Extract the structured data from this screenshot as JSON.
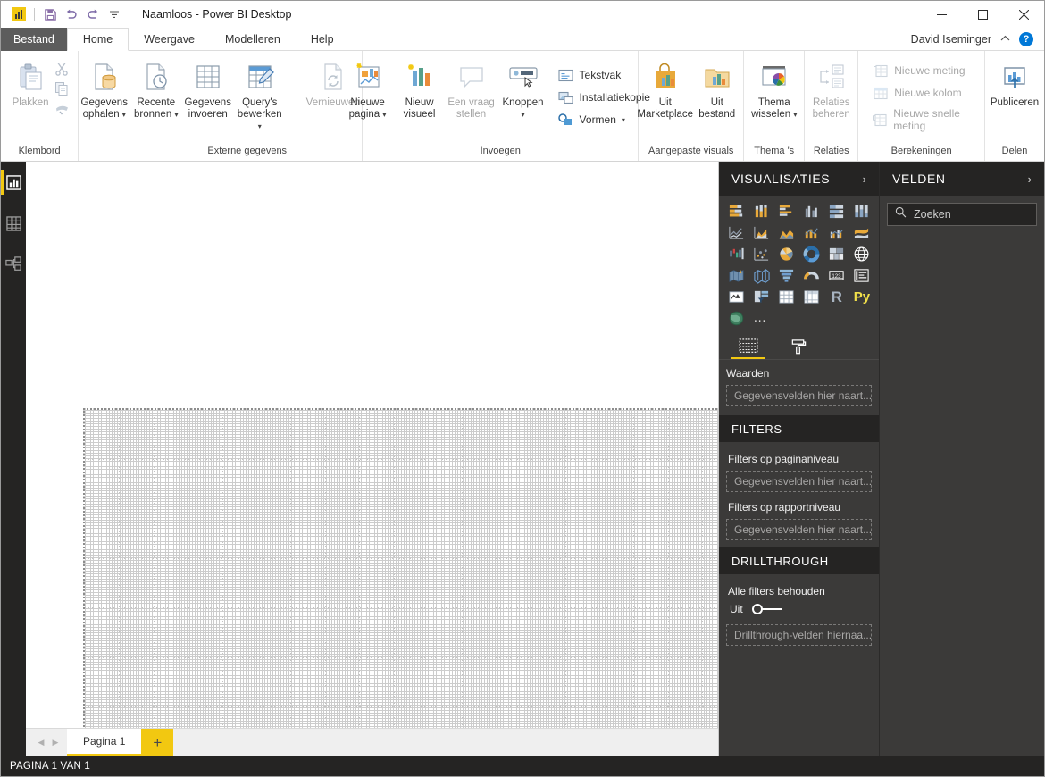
{
  "window": {
    "title": "Naamloos - Power BI Desktop",
    "minimize": "—",
    "maximize": "☐",
    "close": "✕",
    "quick_access": [
      "pbi-logo-icon",
      "save-icon",
      "undo-icon",
      "redo-icon",
      "customize-qat-icon"
    ]
  },
  "tabs": [
    {
      "label": "Bestand",
      "name": "tab-bestand"
    },
    {
      "label": "Home",
      "name": "tab-home"
    },
    {
      "label": "Weergave",
      "name": "tab-weergave"
    },
    {
      "label": "Modelleren",
      "name": "tab-modelleren"
    },
    {
      "label": "Help",
      "name": "tab-help"
    }
  ],
  "account": {
    "user_name": "David Iseminger",
    "collapse_ribbon": "⌃",
    "help": "?"
  },
  "ribbon": {
    "groups": [
      {
        "label": "Klembord",
        "buttons": [
          {
            "label": "Plakken",
            "icon": "paste-icon",
            "disabled": true
          },
          {
            "label": "Knippen",
            "icon": "cut-icon",
            "disabled": true
          },
          {
            "label": "Kopiëren",
            "icon": "copy-icon",
            "disabled": true
          },
          {
            "label": "Opmaak kopiëren/plakken",
            "icon": "format-painter-icon",
            "disabled": true
          }
        ]
      },
      {
        "label": "Externe gegevens",
        "buttons": [
          {
            "label": "Gegevens ophalen",
            "icon": "get-data-icon",
            "caret": true
          },
          {
            "label": "Recente bronnen",
            "icon": "recent-sources-icon",
            "caret": true
          },
          {
            "label": "Gegevens invoeren",
            "icon": "enter-data-icon",
            "caret": false
          },
          {
            "label": "Query's bewerken",
            "icon": "edit-queries-icon",
            "caret": true
          },
          {
            "label": "Vernieuwen",
            "icon": "refresh-icon",
            "caret": false,
            "disabled": true
          }
        ]
      },
      {
        "label": "Invoegen",
        "buttons": [
          {
            "label": "Nieuwe pagina",
            "icon": "new-page-icon",
            "caret": true
          },
          {
            "label": "Nieuw visueel",
            "icon": "new-visual-icon",
            "caret": false
          },
          {
            "label": "Een vraag stellen",
            "icon": "ask-question-icon",
            "caret": false,
            "disabled": true
          },
          {
            "label": "Knoppen",
            "icon": "buttons-icon",
            "caret": true
          }
        ],
        "small_buttons": [
          {
            "label": "Tekstvak",
            "icon": "text-box-icon"
          },
          {
            "label": "Installatiekopie",
            "icon": "image-icon"
          },
          {
            "label": "Vormen",
            "icon": "shapes-icon",
            "caret": true
          }
        ]
      },
      {
        "label": "Aangepaste visuals",
        "buttons": [
          {
            "label": "Uit Marketplace",
            "icon": "marketplace-icon"
          },
          {
            "label": "Uit bestand",
            "icon": "from-file-icon"
          }
        ]
      },
      {
        "label": "Thema 's",
        "buttons": [
          {
            "label": "Thema wisselen",
            "icon": "switch-theme-icon",
            "caret": true
          }
        ]
      },
      {
        "label": "Relaties",
        "buttons": [
          {
            "label": "Relaties beheren",
            "icon": "manage-relationships-icon",
            "disabled": true
          }
        ]
      },
      {
        "label": "Berekeningen",
        "small_buttons": [
          {
            "label": "Nieuwe meting",
            "icon": "new-measure-icon",
            "disabled": true
          },
          {
            "label": "Nieuwe kolom",
            "icon": "new-column-icon",
            "disabled": true
          },
          {
            "label": "Nieuwe snelle meting",
            "icon": "new-quick-measure-icon",
            "disabled": true
          }
        ]
      },
      {
        "label": "Delen",
        "buttons": [
          {
            "label": "Publiceren",
            "icon": "publish-icon"
          }
        ]
      }
    ]
  },
  "rail": [
    {
      "name": "view-report",
      "icon": "report-view-icon",
      "active": true
    },
    {
      "name": "view-data",
      "icon": "data-view-icon",
      "active": false
    },
    {
      "name": "view-model",
      "icon": "model-view-icon",
      "active": false
    }
  ],
  "visualizations": {
    "title": "VISUALISATIES",
    "expand_icon": "›",
    "icons": [
      "stacked-bar-chart",
      "stacked-column-chart",
      "clustered-bar-chart",
      "clustered-column-chart",
      "100-stacked-bar-chart",
      "100-stacked-column-chart",
      "line-chart",
      "area-chart",
      "stacked-area-chart",
      "line-and-stacked-column-chart",
      "line-and-clustered-column-chart",
      "ribbon-chart",
      "waterfall-chart",
      "scatter-chart",
      "pie-chart",
      "donut-chart",
      "treemap",
      "map",
      "filled-map",
      "shape-map",
      "funnel",
      "gauge",
      "card",
      "multi-row-card",
      "kpi",
      "slicer",
      "table",
      "matrix",
      "r-script-visual",
      "python-visual",
      "arcgis-map"
    ],
    "more_icon": "…",
    "field_tabs": [
      {
        "name": "fields-tab",
        "icon": "fields-well-icon",
        "active": true
      },
      {
        "name": "format-tab",
        "icon": "paint-roller-icon",
        "active": false
      }
    ],
    "values_label": "Waarden",
    "values_placeholder": "Gegevensvelden hier naart...",
    "filters_title": "FILTERS",
    "page_level_filters_label": "Filters op paginaniveau",
    "page_level_filters_placeholder": "Gegevensvelden hier naart...",
    "report_level_filters_label": "Filters op rapportniveau",
    "report_level_filters_placeholder": "Gegevensvelden hier naart...",
    "drillthrough_title": "DRILLTHROUGH",
    "keep_all_filters_label": "Alle filters behouden",
    "toggle_state": "Uit",
    "drillthrough_placeholder": "Drillthrough-velden hiernaa..."
  },
  "fields": {
    "title": "VELDEN",
    "expand_icon": "›",
    "search_placeholder": "Zoeken",
    "search_value": "",
    "search_icon": "search-icon"
  },
  "pages": {
    "prev_icon": "◀",
    "next_icon": "▶",
    "tabs": [
      {
        "label": "Pagina 1",
        "active": true
      }
    ],
    "add_label": "+"
  },
  "statusbar": {
    "text": "PAGINA 1 VAN 1"
  },
  "colors": {
    "brand_yellow": "#f2c811",
    "pane_dark": "#3b3a39",
    "pane_header_dark": "#252423",
    "file_tab": "#5c5c5c",
    "help_blue": "#0078d7"
  }
}
